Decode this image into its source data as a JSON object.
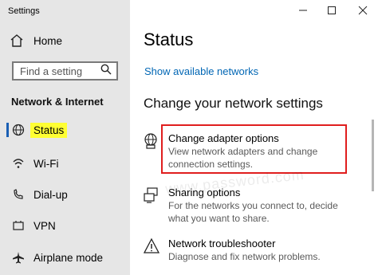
{
  "window": {
    "title": "Settings"
  },
  "sidebar": {
    "home_label": "Home",
    "search_placeholder": "Find a setting",
    "section_heading": "Network & Internet",
    "items": [
      {
        "label": "Status",
        "icon": "globe-icon",
        "selected": true
      },
      {
        "label": "Wi-Fi",
        "icon": "wifi-icon"
      },
      {
        "label": "Dial-up",
        "icon": "phone-icon"
      },
      {
        "label": "VPN",
        "icon": "vpn-icon"
      },
      {
        "label": "Airplane mode",
        "icon": "airplane-icon"
      }
    ]
  },
  "main": {
    "title": "Status",
    "link_label": "Show available networks",
    "section_heading": "Change your network settings",
    "options": [
      {
        "title": "Change adapter options",
        "description": "View network adapters and change connection settings.",
        "icon": "network-adapter-icon"
      },
      {
        "title": "Sharing options",
        "description": "For the networks you connect to, decide what you want to share.",
        "icon": "sharing-icon"
      },
      {
        "title": "Network troubleshooter",
        "description": "Diagnose and fix network problems.",
        "icon": "warning-icon"
      }
    ]
  },
  "watermark": "www.password.com",
  "colors": {
    "accent": "#0066b4",
    "highlight": "#ffff33",
    "annotation": "#e01e1e"
  }
}
